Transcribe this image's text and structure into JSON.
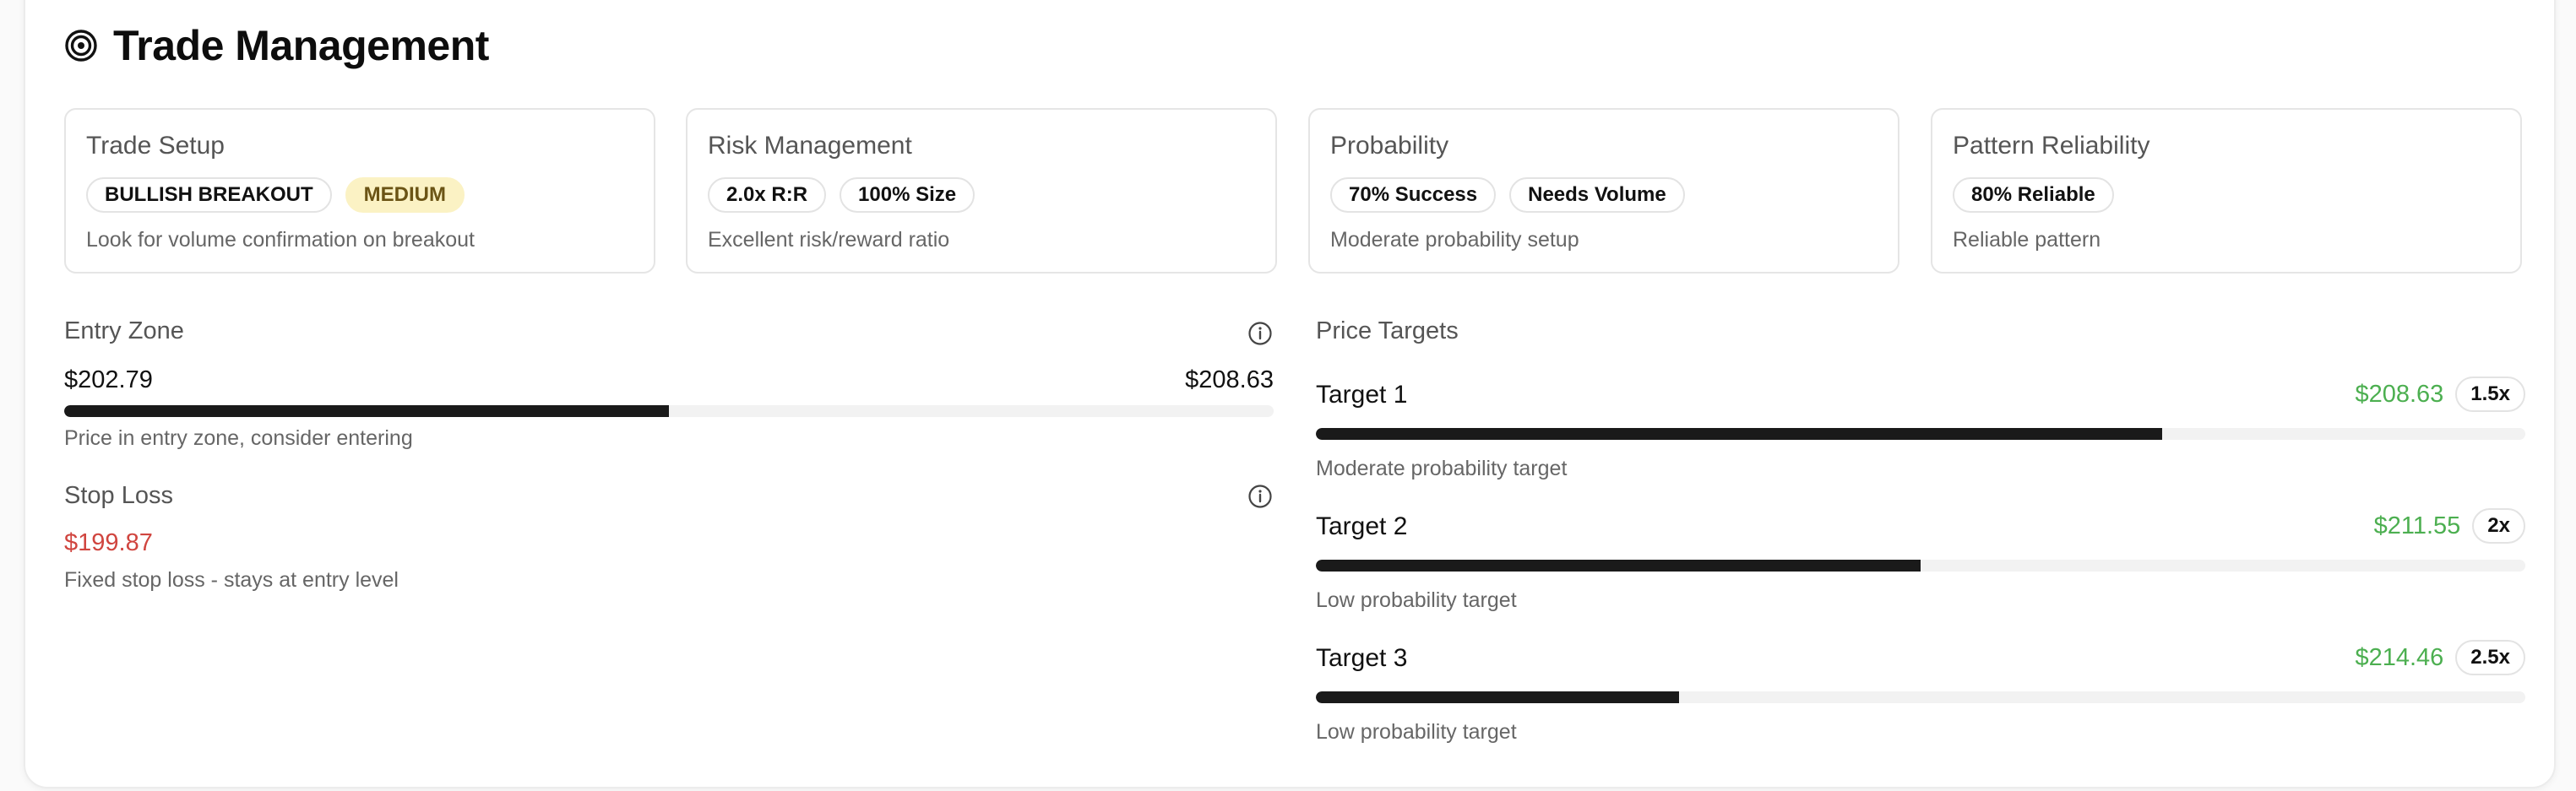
{
  "header": {
    "title": "Trade Management",
    "icon": "target-icon"
  },
  "cards": [
    {
      "title": "Trade Setup",
      "badges": [
        "BULLISH BREAKOUT",
        "MEDIUM"
      ],
      "desc": "Look for volume confirmation on breakout"
    },
    {
      "title": "Risk Management",
      "badges": [
        "2.0x R:R",
        "100% Size"
      ],
      "desc": "Excellent risk/reward ratio"
    },
    {
      "title": "Probability",
      "badges": [
        "70% Success",
        "Needs Volume"
      ],
      "desc": "Moderate probability setup"
    },
    {
      "title": "Pattern Reliability",
      "badges": [
        "80% Reliable"
      ],
      "desc": "Reliable pattern"
    }
  ],
  "entry_zone": {
    "title": "Entry Zone",
    "low": "$202.79",
    "high": "$208.63",
    "progress": 0.5,
    "note": "Price in entry zone, consider entering"
  },
  "stop_loss": {
    "title": "Stop Loss",
    "price": "$199.87",
    "note": "Fixed stop loss - stays at entry level"
  },
  "price_targets": {
    "title": "Price Targets",
    "items": [
      {
        "name": "Target 1",
        "price": "$208.63",
        "multiple": "1.5x",
        "progress": 0.7,
        "note": "Moderate probability target"
      },
      {
        "name": "Target 2",
        "price": "$211.55",
        "multiple": "2x",
        "progress": 0.5,
        "note": "Low probability target"
      },
      {
        "name": "Target 3",
        "price": "$214.46",
        "multiple": "2.5x",
        "progress": 0.3,
        "note": "Low probability target"
      }
    ]
  },
  "colors": {
    "positive": "#4caf50",
    "negative": "#d0453f",
    "warning_bg": "#fbf2c4",
    "bar": "#1a1a1a"
  }
}
